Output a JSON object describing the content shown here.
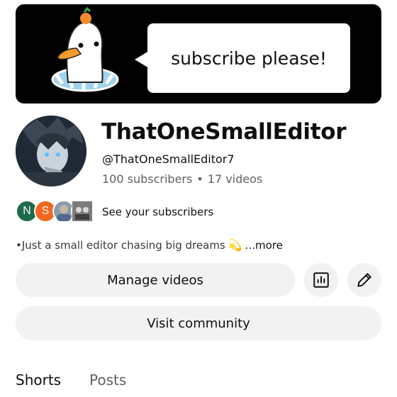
{
  "banner": {
    "text": "subscribe please!"
  },
  "channel": {
    "name": "ThatOneSmallEditor",
    "handle": "@ThatOneSmallEditor7",
    "subscribers": "100 subscribers",
    "videos": "17 videos",
    "separator": "•"
  },
  "subscribers_preview": {
    "avatars": [
      {
        "letter": "N",
        "color": "#1e6b4a"
      },
      {
        "letter": "S",
        "color": "#f2661f"
      },
      {
        "letter": "",
        "color": "#8a9bb0"
      },
      {
        "letter": "",
        "color": "#6b6b6b"
      }
    ],
    "label": "See your subscribers"
  },
  "bio": {
    "text": "•Just a small editor chasing big dreams",
    "emoji": "💫",
    "more": "...more"
  },
  "buttons": {
    "manage": "Manage videos",
    "analytics_icon": "analytics-icon",
    "edit_icon": "pencil-icon",
    "community": "Visit community"
  },
  "tabs": [
    {
      "label": "Shorts",
      "active": true
    },
    {
      "label": "Posts",
      "active": false
    }
  ]
}
